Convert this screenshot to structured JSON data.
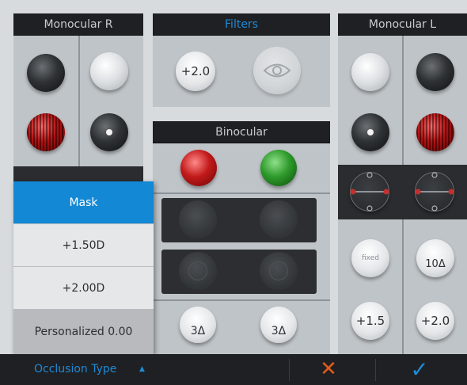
{
  "panels": {
    "monocular_r": "Monocular R",
    "filters": "Filters",
    "binocular": "Binocular",
    "monocular_l": "Monocular L"
  },
  "filters": {
    "lens_value": "+2.0"
  },
  "monocular_l_buttons": {
    "fixed_label": "fixed",
    "prism_label": "10Δ",
    "plus_15": "+1.5",
    "plus_20": "+2.0"
  },
  "binocular_buttons": {
    "prism_left": "3Δ",
    "prism_right": "3Δ"
  },
  "occlusion_menu": {
    "items": [
      "Mask",
      "+1.50D",
      "+2.00D",
      "Personalized 0.00"
    ],
    "selected": "Mask"
  },
  "bottom_bar": {
    "occlusion_label": "Occlusion Type",
    "arrow": "▲",
    "cancel": "✕",
    "confirm": "✓"
  }
}
